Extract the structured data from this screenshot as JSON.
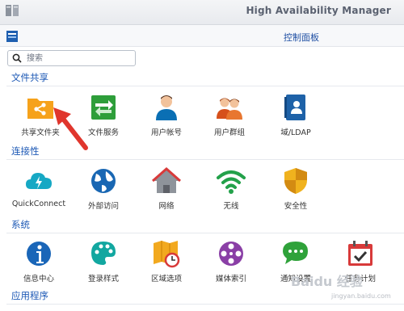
{
  "window": {
    "title": "High Availability Manager"
  },
  "panel": {
    "title": "控制面板"
  },
  "search": {
    "placeholder": "搜索"
  },
  "sections": [
    {
      "title": "文件共享",
      "items": [
        {
          "label": "共享文件夹",
          "icon": "shared-folder-icon",
          "color": "#f6a21b"
        },
        {
          "label": "文件服务",
          "icon": "file-services-icon",
          "color": "#2e9e3a"
        },
        {
          "label": "用户帐号",
          "icon": "user-icon",
          "color": "#0a6fb4"
        },
        {
          "label": "用户群组",
          "icon": "user-group-icon",
          "color": "#d6501b"
        },
        {
          "label": "域/LDAP",
          "icon": "domain-ldap-icon",
          "color": "#1e62a8"
        }
      ]
    },
    {
      "title": "连接性",
      "items": [
        {
          "label": "QuickConnect",
          "icon": "quickconnect-cloud-icon",
          "color": "#16a8c4"
        },
        {
          "label": "外部访问",
          "icon": "globe-icon",
          "color": "#1967b3"
        },
        {
          "label": "网络",
          "icon": "house-icon",
          "color": "#7a7f86"
        },
        {
          "label": "无线",
          "icon": "wifi-icon",
          "color": "#23a14a"
        },
        {
          "label": "安全性",
          "icon": "shield-icon",
          "color": "#f0b21e"
        }
      ]
    },
    {
      "title": "系统",
      "items": [
        {
          "label": "信息中心",
          "icon": "info-icon",
          "color": "#1a66b8"
        },
        {
          "label": "登录样式",
          "icon": "palette-icon",
          "color": "#12a7a0"
        },
        {
          "label": "区域选项",
          "icon": "map-clock-icon",
          "color": "#f2a91f"
        },
        {
          "label": "媒体索引",
          "icon": "film-reel-icon",
          "color": "#8a3fa6"
        },
        {
          "label": "通知设置",
          "icon": "chat-bubble-icon",
          "color": "#2fa23a"
        },
        {
          "label": "任务计划",
          "icon": "calendar-check-icon",
          "color": "#d83a3a"
        }
      ]
    },
    {
      "title": "应用程序",
      "items": []
    }
  ],
  "watermark": {
    "text": "Baidu 经验",
    "sub": "jingyan.baidu.com"
  }
}
